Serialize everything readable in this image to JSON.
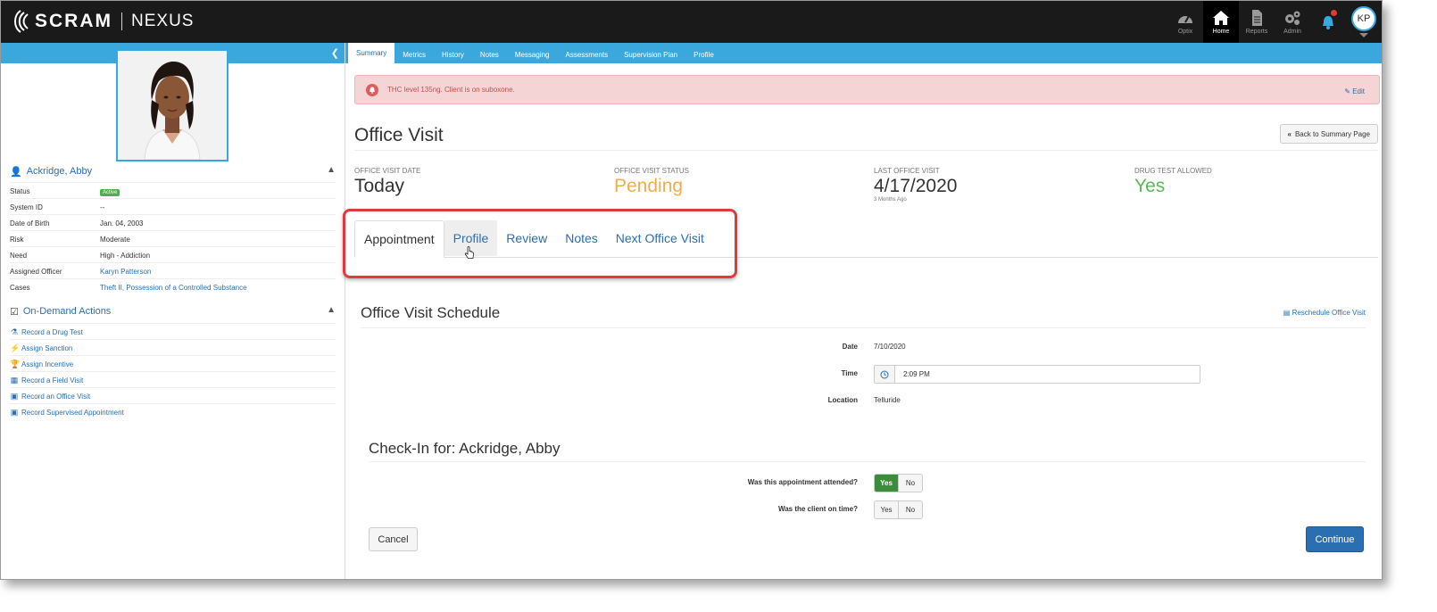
{
  "app": {
    "brand_main": "SCRAM",
    "brand_sub": "NEXUS"
  },
  "topnav": {
    "items": [
      {
        "label": "Optix",
        "icon": "gauge-icon"
      },
      {
        "label": "Home",
        "icon": "home-icon",
        "active": true
      },
      {
        "label": "Reports",
        "icon": "document-icon"
      },
      {
        "label": "Admin",
        "icon": "gears-icon"
      }
    ],
    "user_initials": "KP"
  },
  "sidebar": {
    "client_name": "Ackridge, Abby",
    "info": [
      {
        "key": "Status",
        "value": "Active",
        "type": "badge"
      },
      {
        "key": "System ID",
        "value": "--"
      },
      {
        "key": "Date of Birth",
        "value": "Jan. 04, 2003"
      },
      {
        "key": "Risk",
        "value": "Moderate"
      },
      {
        "key": "Need",
        "value": "High - Addiction"
      },
      {
        "key": "Assigned Officer",
        "value": "Karyn Patterson",
        "type": "link"
      },
      {
        "key": "Cases",
        "value": "Theft II, Possession of a Controlled Substance",
        "type": "link"
      }
    ],
    "actions_title": "On-Demand Actions",
    "actions": [
      {
        "label": "Record a Drug Test",
        "icon": "flask-icon"
      },
      {
        "label": "Assign Sanction",
        "icon": "bolt-icon"
      },
      {
        "label": "Assign Incentive",
        "icon": "trophy-icon"
      },
      {
        "label": "Record a Field Visit",
        "icon": "map-icon"
      },
      {
        "label": "Record an Office Visit",
        "icon": "building-icon"
      },
      {
        "label": "Record Supervised Appointment",
        "icon": "building-icon"
      }
    ]
  },
  "tabs": [
    "Summary",
    "Metrics",
    "History",
    "Notes",
    "Messaging",
    "Assessments",
    "Supervision Plan",
    "Profile"
  ],
  "alert": {
    "text": "THC level 135ng. Client is on suboxone.",
    "edit_label": "Edit"
  },
  "page": {
    "title": "Office Visit",
    "back_label": "Back to Summary Page"
  },
  "stats": [
    {
      "label": "OFFICE VISIT DATE",
      "value": "Today"
    },
    {
      "label": "OFFICE VISIT STATUS",
      "value": "Pending"
    },
    {
      "label": "LAST OFFICE VISIT",
      "value": "4/17/2020",
      "sub": "3 Months Ago"
    },
    {
      "label": "DRUG TEST ALLOWED",
      "value": "Yes"
    }
  ],
  "subtabs": [
    "Appointment",
    "Profile",
    "Review",
    "Notes",
    "Next Office Visit"
  ],
  "schedule": {
    "title": "Office Visit Schedule",
    "reschedule_label": "Reschedule Office Visit",
    "date_label": "Date",
    "date_value": "7/10/2020",
    "time_label": "Time",
    "time_value": "2:09 PM",
    "location_label": "Location",
    "location_value": "Telluride"
  },
  "checkin": {
    "title": "Check-In for: Ackridge, Abby",
    "q1": "Was this appointment attended?",
    "q2": "Was the client on time?",
    "yes": "Yes",
    "no": "No"
  },
  "buttons": {
    "cancel": "Cancel",
    "continue": "Continue"
  },
  "colors": {
    "accent_blue": "#3aa8dc",
    "link_blue": "#2a6fb2",
    "pending_orange": "#f0ad4e",
    "yes_green": "#5cb85c",
    "highlight_red": "#e0393e"
  }
}
